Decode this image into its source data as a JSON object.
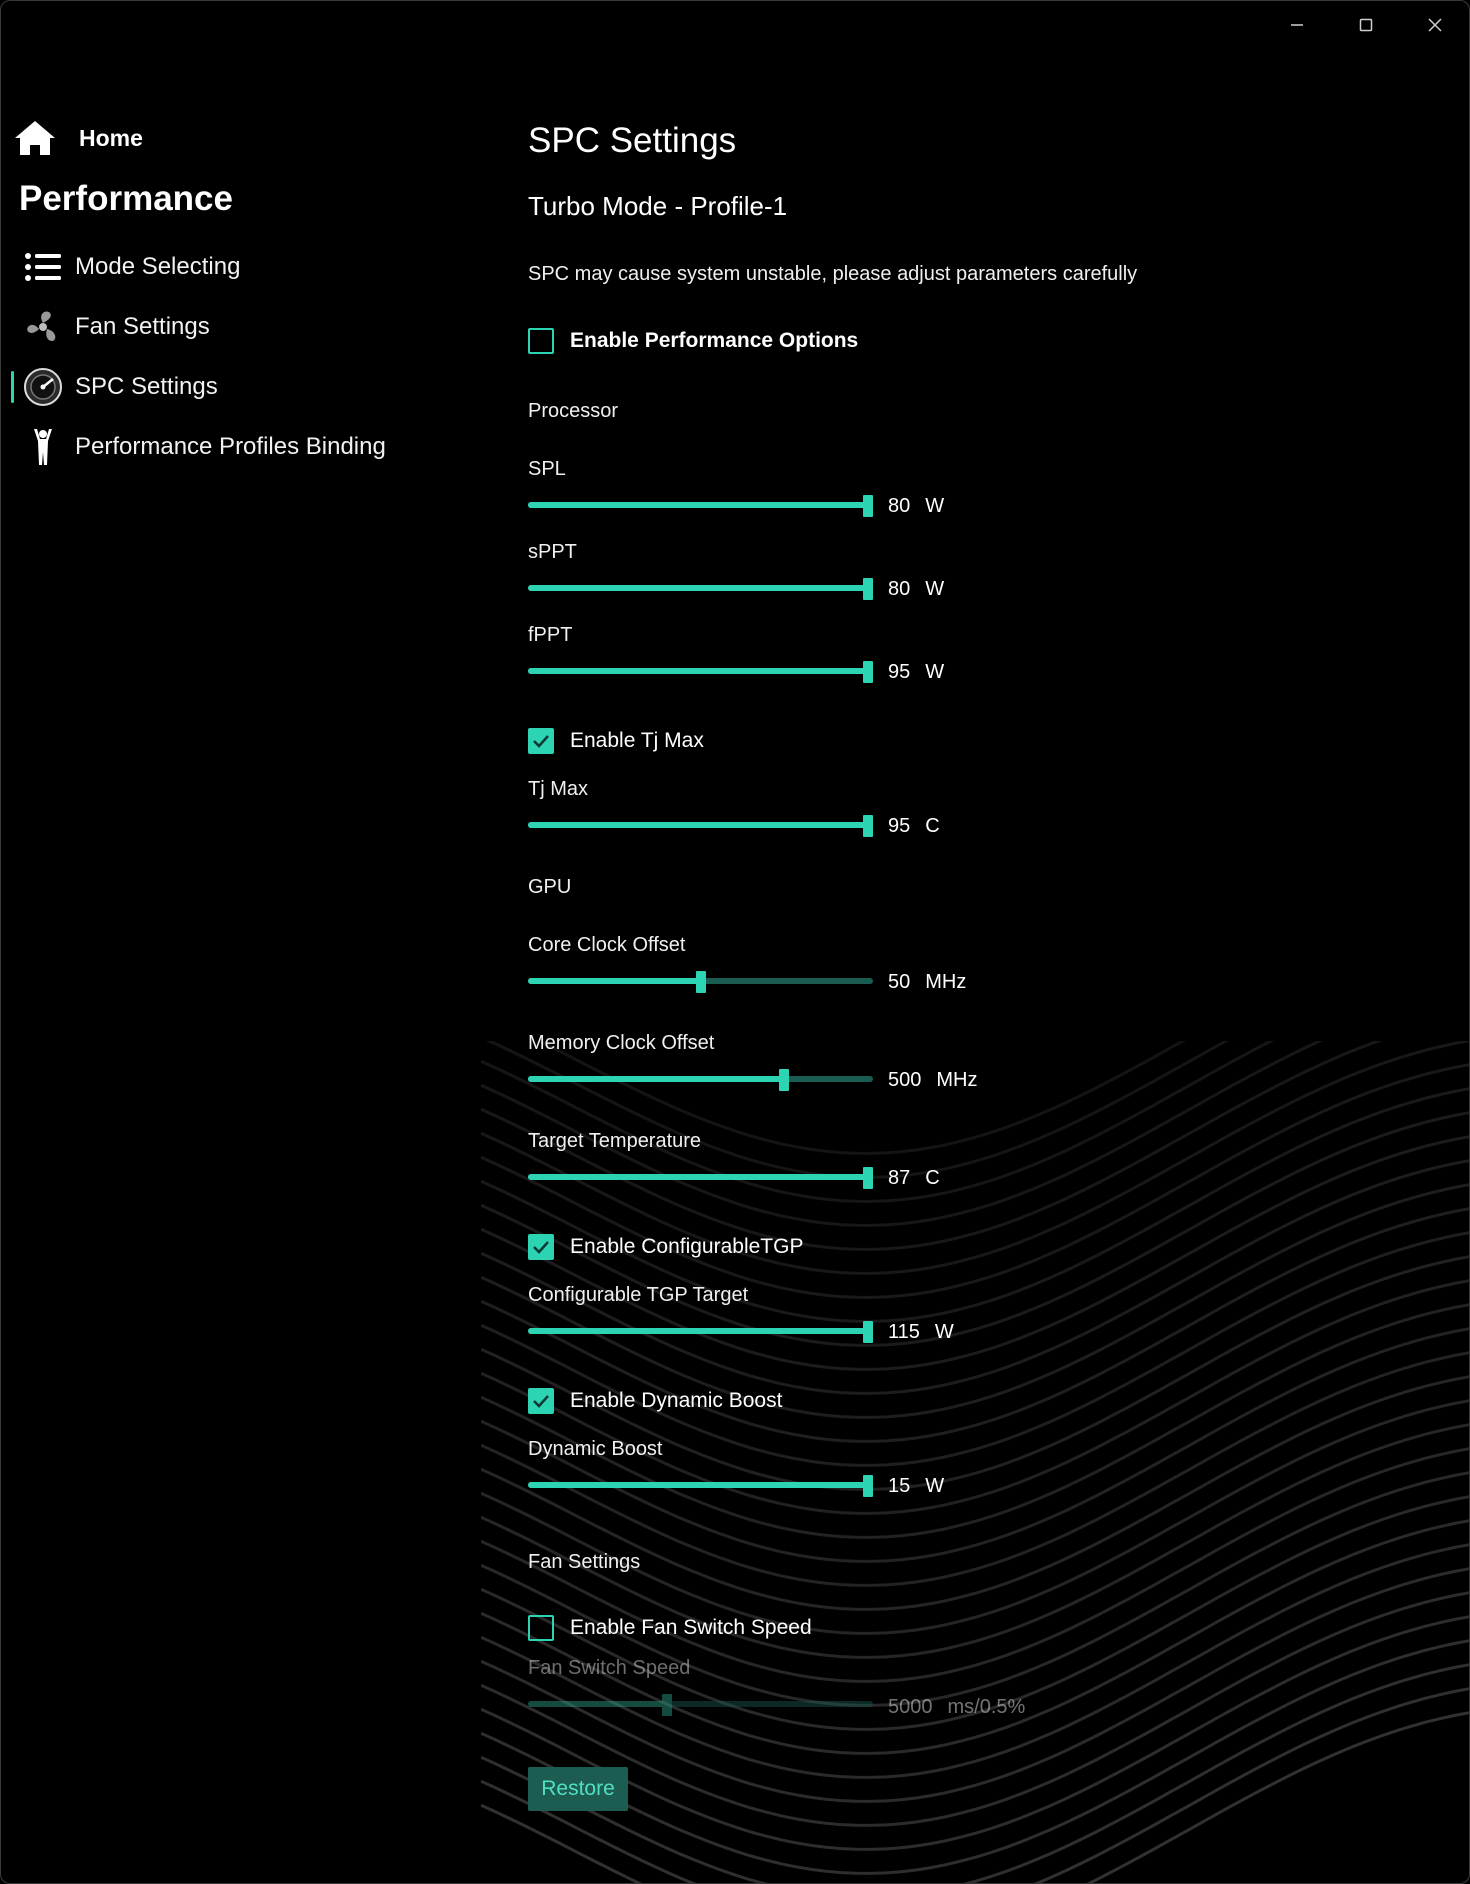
{
  "window": {
    "controls": [
      "minimize-icon",
      "maximize-icon",
      "close-icon"
    ]
  },
  "sidebar": {
    "home_label": "Home",
    "section_title": "Performance",
    "items": [
      {
        "label": "Mode Selecting",
        "icon": "list-icon",
        "selected": false
      },
      {
        "label": "Fan Settings",
        "icon": "fan-icon",
        "selected": false
      },
      {
        "label": "SPC Settings",
        "icon": "gauge-icon",
        "selected": true
      },
      {
        "label": "Performance Profiles Binding",
        "icon": "person-icon",
        "selected": false
      }
    ]
  },
  "main": {
    "title": "SPC Settings",
    "subtitle": "Turbo Mode - Profile-1",
    "warning": "SPC may cause system unstable, please adjust parameters carefully",
    "enable_performance": {
      "label": "Enable Performance Options",
      "checked": false
    },
    "processor_heading": "Processor",
    "spl": {
      "label": "SPL",
      "value": "80",
      "unit": "W",
      "fraction": 1.0
    },
    "sppt": {
      "label": "sPPT",
      "value": "80",
      "unit": "W",
      "fraction": 1.0
    },
    "fppt": {
      "label": "fPPT",
      "value": "95",
      "unit": "W",
      "fraction": 1.0
    },
    "enable_tjmax": {
      "label": "Enable Tj Max",
      "checked": true
    },
    "tjmax": {
      "label": "Tj Max",
      "value": "95",
      "unit": "C",
      "fraction": 1.0
    },
    "gpu_heading": "GPU",
    "core_clock": {
      "label": "Core Clock Offset",
      "value": "50",
      "unit": "MHz",
      "fraction": 0.5
    },
    "memory_clock": {
      "label": "Memory Clock Offset",
      "value": "500",
      "unit": "MHz",
      "fraction": 0.75
    },
    "target_temp": {
      "label": "Target Temperature",
      "value": "87",
      "unit": "C",
      "fraction": 1.0
    },
    "enable_tgp": {
      "label": "Enable ConfigurableTGP",
      "checked": true
    },
    "tgp_target": {
      "label": "Configurable TGP Target",
      "value": "115",
      "unit": "W",
      "fraction": 1.0
    },
    "enable_dynamic_boost": {
      "label": "Enable Dynamic Boost",
      "checked": true
    },
    "dynamic_boost": {
      "label": "Dynamic Boost",
      "value": "15",
      "unit": "W",
      "fraction": 1.0
    },
    "fan_heading": "Fan Settings",
    "enable_fan_switch": {
      "label": "Enable Fan Switch Speed",
      "checked": false
    },
    "fan_switch_speed": {
      "label": "Fan Switch Speed",
      "value": "5000",
      "unit": "ms/0.5%",
      "fraction": 0.4
    },
    "restore_label": "Restore"
  },
  "colors": {
    "accent": "#2dd4b4",
    "track": "#1b5c52",
    "background": "#000000"
  }
}
